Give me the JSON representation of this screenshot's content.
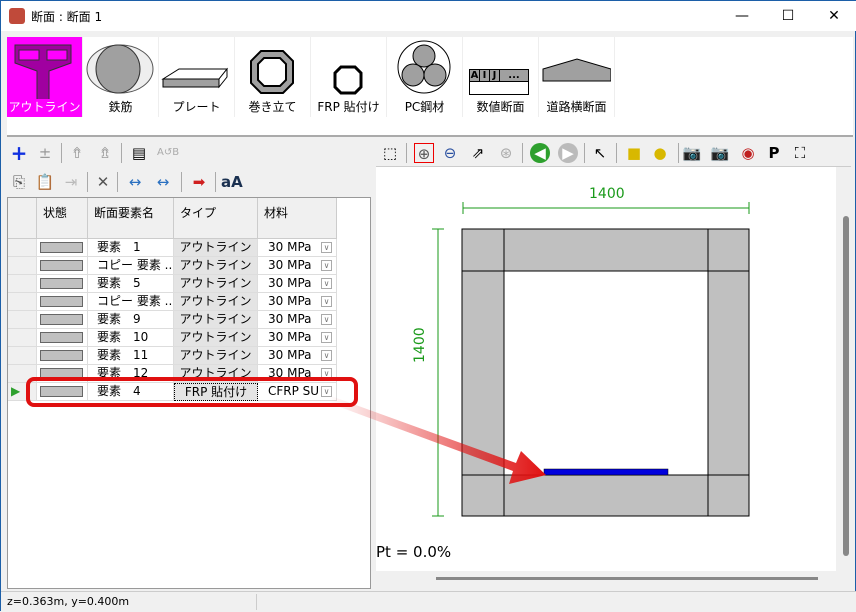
{
  "window": {
    "title": "断面 : 断面 1",
    "minimize": "—",
    "maximize": "☐",
    "close": "✕"
  },
  "palette": [
    {
      "label": "アウトライン",
      "icon": "outline-icon"
    },
    {
      "label": "鉄筋",
      "icon": "rebar-icon"
    },
    {
      "label": "プレート",
      "icon": "plate-icon"
    },
    {
      "label": "巻き立て",
      "icon": "jacketing-icon"
    },
    {
      "label": "FRP 貼付け",
      "icon": "frp-icon"
    },
    {
      "label": "PC鋼材",
      "icon": "pc-steel-icon"
    },
    {
      "label": "数値断面",
      "icon": "numeric-section-icon"
    },
    {
      "label": "道路横断面",
      "icon": "road-section-icon"
    }
  ],
  "numeric_icon_cols": [
    "A",
    "I",
    "J",
    "..."
  ],
  "grid": {
    "headers": [
      "状態",
      "断面要素名",
      "タイプ",
      "材料"
    ],
    "rows": [
      {
        "name": "要素　1",
        "type": "アウトライン",
        "material": "30 MPa"
      },
      {
        "name": "コピー 要素 ...",
        "type": "アウトライン",
        "material": "30 MPa"
      },
      {
        "name": "要素　5",
        "type": "アウトライン",
        "material": "30 MPa"
      },
      {
        "name": "コピー 要素 ...",
        "type": "アウトライン",
        "material": "30 MPa"
      },
      {
        "name": "要素　9",
        "type": "アウトライン",
        "material": "30 MPa"
      },
      {
        "name": "要素　10",
        "type": "アウトライン",
        "material": "30 MPa"
      },
      {
        "name": "要素　11",
        "type": "アウトライン",
        "material": "30 MPa"
      },
      {
        "name": "要素　12",
        "type": "アウトライン",
        "material": "30 MPa"
      },
      {
        "name": "要素　4",
        "type": "FRP 貼付け",
        "material": "CFRP SU"
      }
    ]
  },
  "drawing": {
    "width_label": "1400",
    "height_label": "1400",
    "pt": "Pt = 0.0%",
    "dim_color": "#1a9a1a",
    "frp_color": "#0000dd",
    "highlight_color": "#e01010"
  },
  "status": {
    "coords": "z=0.363m, y=0.400m"
  }
}
